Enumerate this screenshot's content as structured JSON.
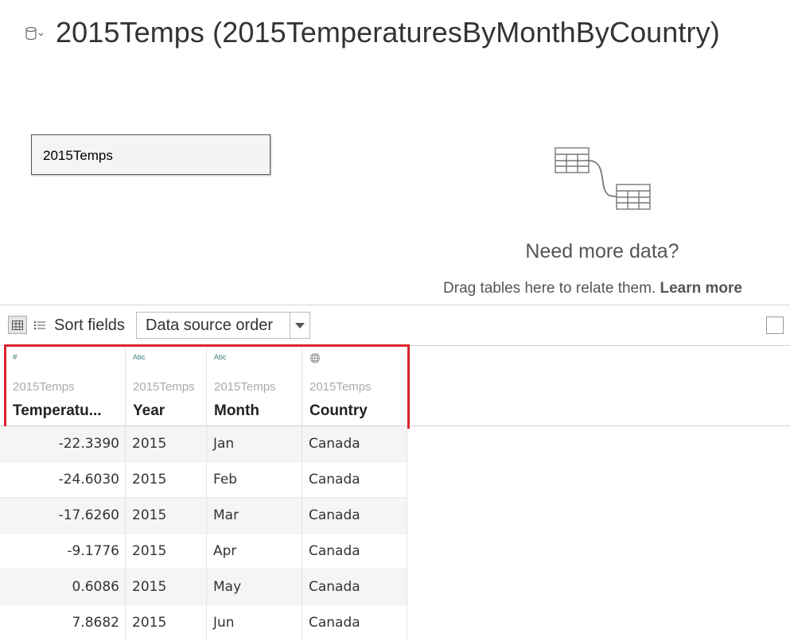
{
  "datasource": {
    "title": "2015Temps (2015TemperaturesByMonthByCountry)",
    "icon": "database-icon"
  },
  "canvas": {
    "table_name": "2015Temps"
  },
  "relate_panel": {
    "title": "Need more data?",
    "hint": "Drag tables here to relate them.",
    "link": "Learn more"
  },
  "toolbar": {
    "sort_label": "Sort fields",
    "sort_value": "Data source order"
  },
  "grid": {
    "columns": [
      {
        "type_glyph": "#",
        "source": "2015Temps",
        "name": "Temperatu..."
      },
      {
        "type_glyph": "Abc",
        "source": "2015Temps",
        "name": "Year"
      },
      {
        "type_glyph": "Abc",
        "source": "2015Temps",
        "name": "Month"
      },
      {
        "type_glyph": "🌐",
        "source": "2015Temps",
        "name": "Country"
      }
    ],
    "rows": [
      [
        "-22.3390",
        "2015",
        "Jan",
        "Canada"
      ],
      [
        "-24.6030",
        "2015",
        "Feb",
        "Canada"
      ],
      [
        "-17.6260",
        "2015",
        "Mar",
        "Canada"
      ],
      [
        "-9.1776",
        "2015",
        "Apr",
        "Canada"
      ],
      [
        "0.6086",
        "2015",
        "May",
        "Canada"
      ],
      [
        "7.8682",
        "2015",
        "Jun",
        "Canada"
      ]
    ]
  },
  "colors": {
    "highlight": "#d9232e",
    "type_icon": "#3a7d7c"
  }
}
